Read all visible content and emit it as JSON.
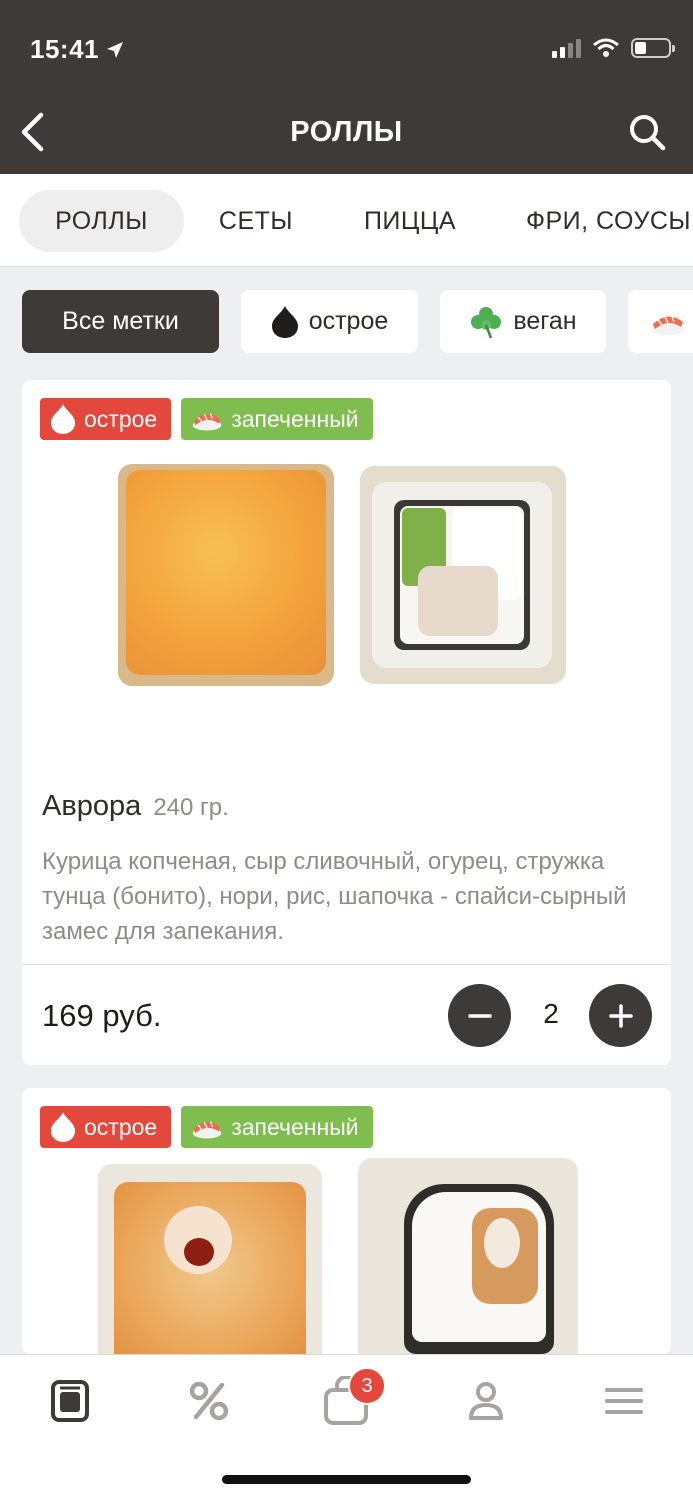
{
  "status_bar": {
    "time": "15:41"
  },
  "header": {
    "title": "РОЛЛЫ"
  },
  "categories": [
    {
      "label": "РОЛЛЫ",
      "active": true
    },
    {
      "label": "СЕТЫ",
      "active": false
    },
    {
      "label": "ПИЦЦА",
      "active": false
    },
    {
      "label": "ФРИ, СОУСЫ",
      "active": false
    }
  ],
  "filter_tags": [
    {
      "label": "Все метки",
      "icon": null,
      "active": true
    },
    {
      "label": "острое",
      "icon": "flame-icon",
      "active": false
    },
    {
      "label": "веган",
      "icon": "clover-icon",
      "active": false
    },
    {
      "label": "",
      "icon": "sushi-icon",
      "active": false
    }
  ],
  "products": [
    {
      "badges": [
        {
          "label": "острое",
          "icon": "flame-icon",
          "color": "#e4473c"
        },
        {
          "label": "запеченный",
          "icon": "sushi-icon",
          "color": "#7ebd4e"
        }
      ],
      "name": "Аврора",
      "weight": "240 гр.",
      "description": "Курица копченая, сыр сливочный, огурец, стружка тунца (бонито), нори, рис, шапочка - спайси-сырный замес для запекания.",
      "price": "169 руб.",
      "quantity": "2"
    },
    {
      "badges": [
        {
          "label": "острое",
          "icon": "flame-icon",
          "color": "#e4473c"
        },
        {
          "label": "запеченный",
          "icon": "sushi-icon",
          "color": "#7ebd4e"
        }
      ]
    }
  ],
  "bottom_nav": {
    "items": [
      "menu-icon",
      "percent-icon",
      "cart-icon",
      "profile-icon",
      "hamburger-icon"
    ],
    "cart_count": "3"
  },
  "colors": {
    "header": "#3e3a37",
    "spicy": "#e4473c",
    "baked": "#7ebd4e"
  }
}
